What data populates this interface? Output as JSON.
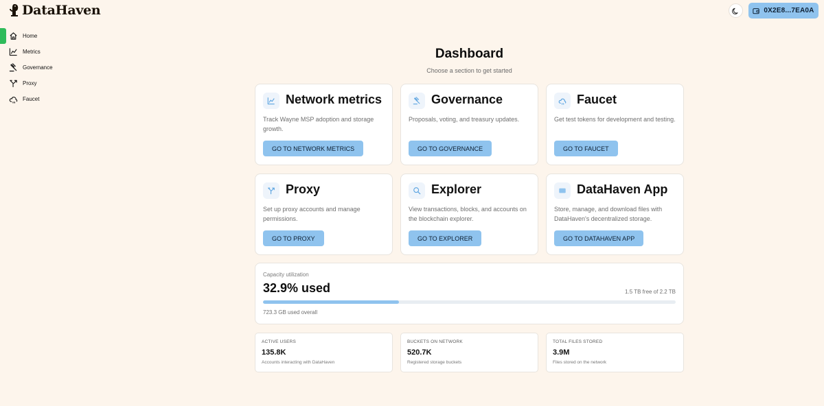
{
  "brand": {
    "name": "DataHaven"
  },
  "header": {
    "theme_icon": "moon-icon",
    "wallet_icon": "wallet-icon",
    "wallet_address": "0X2E8...7EA0A"
  },
  "sidebar": {
    "items": [
      {
        "label": "Home",
        "icon": "home-icon",
        "active": true
      },
      {
        "label": "Metrics",
        "icon": "chart-line-icon"
      },
      {
        "label": "Governance",
        "icon": "gavel-icon"
      },
      {
        "label": "Proxy",
        "icon": "split-arrow-icon"
      },
      {
        "label": "Faucet",
        "icon": "cloud-icon"
      }
    ]
  },
  "dashboard": {
    "title": "Dashboard",
    "subtitle": "Choose a section to get started"
  },
  "cards": [
    {
      "title": "Network metrics",
      "icon": "chart-line-icon",
      "description": "Track Wayne MSP adoption and storage growth.",
      "button": "GO TO NETWORK METRICS"
    },
    {
      "title": "Governance",
      "icon": "gavel-icon",
      "description": "Proposals, voting, and treasury updates.",
      "button": "GO TO GOVERNANCE"
    },
    {
      "title": "Faucet",
      "icon": "cloud-icon",
      "description": "Get test tokens for development and testing.",
      "button": "GO TO FAUCET"
    },
    {
      "title": "Proxy",
      "icon": "split-arrow-icon",
      "description": "Set up proxy accounts and manage permissions.",
      "button": "GO TO PROXY"
    },
    {
      "title": "Explorer",
      "icon": "search-icon",
      "description": "View transactions, blocks, and accounts on the blockchain explorer.",
      "button": "GO TO EXPLORER"
    },
    {
      "title": "DataHaven App",
      "icon": "app-window-icon",
      "description": "Store, manage, and download files with DataHaven's decentralized storage.",
      "button": "GO TO DATAHAVEN APP"
    }
  ],
  "capacity": {
    "label": "Capacity utilization",
    "value": "32.9% used",
    "percent": 32.9,
    "free": "1.5 TB free of 2.2 TB",
    "used": "723.3 GB used overall"
  },
  "stats": [
    {
      "label": "ACTIVE USERS",
      "value": "135.8K",
      "description": "Accounts interacting with DataHaven"
    },
    {
      "label": "BUCKETS ON NETWORK",
      "value": "520.7K",
      "description": "Registered storage buckets"
    },
    {
      "label": "TOTAL FILES STORED",
      "value": "3.9M",
      "description": "Files stored on the network"
    }
  ],
  "colors": {
    "background": "#fdf5ec",
    "accent": "#8fc3ee",
    "active": "#2fbb5a",
    "icon": "#5aa3e0"
  }
}
